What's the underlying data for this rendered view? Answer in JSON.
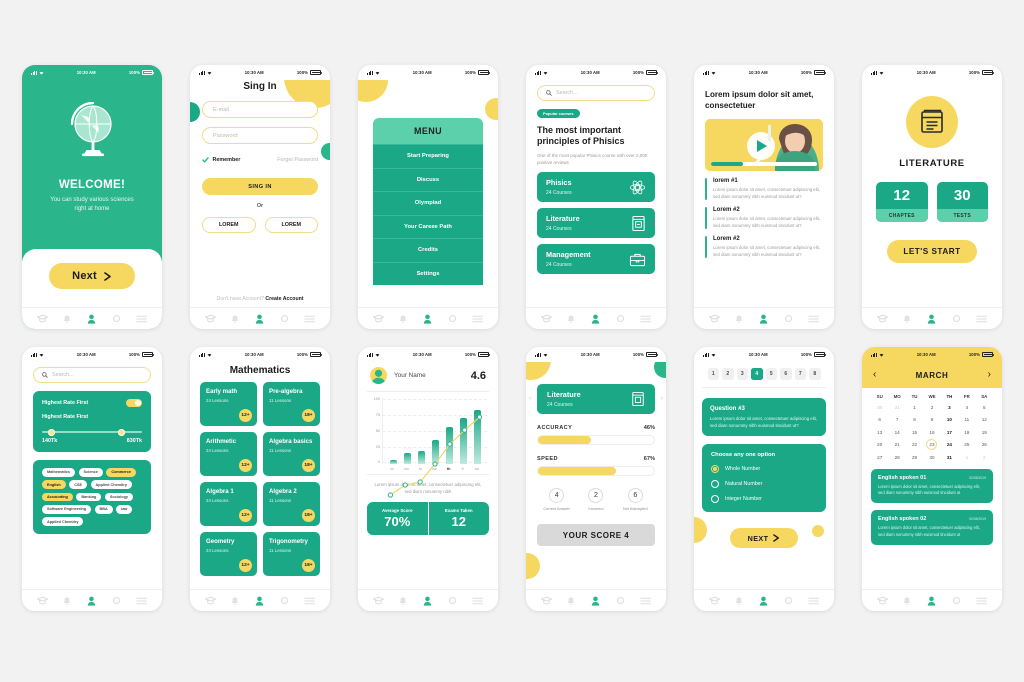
{
  "statusbar": {
    "time": "10:30 AM",
    "battery": "100%"
  },
  "nav": {
    "items": [
      {
        "name": "graduation-cap",
        "active": false
      },
      {
        "name": "bell",
        "active": false
      },
      {
        "name": "person",
        "active": true
      },
      {
        "name": "gear",
        "active": false
      },
      {
        "name": "menu",
        "active": false
      }
    ]
  },
  "colors": {
    "green": "#1aa887",
    "mint": "#2ab58a",
    "light_mint": "#5cd0aa",
    "yellow": "#f6d860",
    "text": "#1c1c1c"
  },
  "screens": {
    "welcome": {
      "title": "WELCOME!",
      "subtitle": "You can study various sciences right at home",
      "next_label": "Next",
      "icon": "globe-icon"
    },
    "signin": {
      "title": "Sing In",
      "email_placeholder": "E-mail",
      "password_placeholder": "Password",
      "remember_label": "Remember",
      "forgot_label": "Forget Password",
      "submit_label": "SING IN",
      "or_label": "Or",
      "social": [
        "LOREM",
        "LOREM"
      ],
      "footer_prefix": "Don't have Account?",
      "footer_link": "Create Account"
    },
    "menu": {
      "header": "MENU",
      "items": [
        "Start Preparing",
        "Discuss",
        "Olympiad",
        "Your Careee Path",
        "Credits",
        "Settings"
      ]
    },
    "courses": {
      "search_placeholder": "Search...",
      "badge": "Popular courses",
      "heading": "The most important principles of Phisics",
      "description": "One of the most popular Phisics course with over 2,000 positive reviews",
      "list": [
        {
          "name": "Phisics",
          "meta": "24 Courses",
          "icon": "atom-icon"
        },
        {
          "name": "Literature",
          "meta": "24 Courses",
          "icon": "book-icon"
        },
        {
          "name": "Management",
          "meta": "24 Courses",
          "icon": "briefcase-icon"
        }
      ]
    },
    "lesson": {
      "heading": "Lorem ipsum dolor sit amet, consectetuer",
      "progress_percent": 30,
      "items": [
        {
          "title": "lorem #1",
          "text": "Lorem ipsum dolor sit amet, consectetuer adipiscing elit, sed diam nonummy nibh euismod tincidunt ut?"
        },
        {
          "title": "Lorem #2",
          "text": "Lorem ipsum dolor sit amet, consectetuer adipiscing elit, sed diam nonummy nibh euismod tincidunt ut?"
        },
        {
          "title": "Lorem #2",
          "text": "Lorem ipsum dolor sit amet, consectetuer adipiscing elit, sed diam nonummy nibh euismod tincidunt ut?"
        }
      ]
    },
    "subject": {
      "title": "LITERATURE",
      "icon": "book-icon",
      "stats": [
        {
          "value": "12",
          "label": "CHAPTES"
        },
        {
          "value": "30",
          "label": "TESTS"
        }
      ],
      "cta": "LET'S START"
    },
    "filter": {
      "search_placeholder": "Search...",
      "toggle_label": "Highest Rate First",
      "slider_label": "Highest Rate First",
      "range_min": "140Tk",
      "range_max": "830Tk",
      "toggle_on": true,
      "tags": [
        {
          "label": "Mathematics",
          "selected": false
        },
        {
          "label": "Science",
          "selected": false
        },
        {
          "label": "Commerce",
          "selected": true
        },
        {
          "label": "English",
          "selected": true
        },
        {
          "label": "CSE",
          "selected": false
        },
        {
          "label": "Applied Chemitry",
          "selected": false
        },
        {
          "label": "Accounting",
          "selected": true
        },
        {
          "label": "Banking",
          "selected": false
        },
        {
          "label": "Sociology",
          "selected": false
        },
        {
          "label": "Software Engineering",
          "selected": false
        },
        {
          "label": "BBA",
          "selected": false
        },
        {
          "label": "law",
          "selected": false
        },
        {
          "label": "Applied Chemitry",
          "selected": false
        }
      ]
    },
    "mathematics": {
      "title": "Mathematics",
      "cards": [
        {
          "name": "Early math",
          "lessons": "24 Lessons",
          "age": "12+"
        },
        {
          "name": "Pre-algebra",
          "lessons": "11 Lessons",
          "age": "18+"
        },
        {
          "name": "Arithmetic",
          "lessons": "24 Lessons",
          "age": "12+"
        },
        {
          "name": "Algebra basics",
          "lessons": "11 Lessons",
          "age": "18+"
        },
        {
          "name": "Algebra 1",
          "lessons": "24 Lessons",
          "age": "12+"
        },
        {
          "name": "Algebra 2",
          "lessons": "11 Lessons",
          "age": "18+"
        },
        {
          "name": "Geometry",
          "lessons": "24 Lessons",
          "age": "12+"
        },
        {
          "name": "Trigonometry",
          "lessons": "11 Lessons",
          "age": "18+"
        }
      ]
    },
    "progress": {
      "user_name": "Your Name",
      "rating": "4.6",
      "note": "Lorem ipsum dolor sit amet, consectetuer adipiscing elit, sed diam nonummy nibh",
      "stats": [
        {
          "label": "Average Score",
          "value": "70%"
        },
        {
          "label": "Exams Taken",
          "value": "12"
        }
      ]
    },
    "score": {
      "course": {
        "name": "Literature",
        "meta": "24 Courses",
        "icon": "book-icon"
      },
      "metrics": [
        {
          "label": "ACCURACY",
          "value": "46%",
          "percent": 46
        },
        {
          "label": "SPEED",
          "value": "67%",
          "percent": 67
        }
      ],
      "counts": [
        {
          "value": "4",
          "label": "Correct Answer"
        },
        {
          "value": "2",
          "label": "Incorrect"
        },
        {
          "value": "6",
          "label": "Not Attempted"
        }
      ],
      "total_label": "YOUR SCORE 4"
    },
    "question": {
      "pages": [
        "1",
        "2",
        "3",
        "4",
        "5",
        "6",
        "7",
        "8"
      ],
      "active_page": "4",
      "question_title": "Question #3",
      "question_text": "Lorem ipsum dolor sit amet, consectetuer adipiscing elit, sed diam nonummy nibh euismod tincidunt ut?",
      "options_title": "Choose any one option",
      "options": [
        {
          "label": "Whole Number",
          "selected": true
        },
        {
          "label": "Natural Number",
          "selected": false
        },
        {
          "label": "Integer Number",
          "selected": false
        }
      ],
      "next_label": "NEXT"
    },
    "calendar": {
      "month": "MARCH",
      "prev_icon": "chevron-left-icon",
      "next_icon": "chevron-right-icon",
      "dow": [
        "SU",
        "MO",
        "TU",
        "WE",
        "TH",
        "FR",
        "SA"
      ],
      "current_dow": "TH",
      "weeks": [
        [
          {
            "d": "30",
            "mute": true
          },
          {
            "d": "31",
            "mute": true
          },
          {
            "d": "1"
          },
          {
            "d": "2"
          },
          {
            "d": "3",
            "bold": true
          },
          {
            "d": "4"
          },
          {
            "d": "5"
          }
        ],
        [
          {
            "d": "6"
          },
          {
            "d": "7"
          },
          {
            "d": "8"
          },
          {
            "d": "9"
          },
          {
            "d": "10",
            "bold": true
          },
          {
            "d": "11"
          },
          {
            "d": "12"
          }
        ],
        [
          {
            "d": "13"
          },
          {
            "d": "14",
            "fill": true
          },
          {
            "d": "15"
          },
          {
            "d": "16"
          },
          {
            "d": "17",
            "bold": true
          },
          {
            "d": "18"
          },
          {
            "d": "19"
          }
        ],
        [
          {
            "d": "20"
          },
          {
            "d": "21"
          },
          {
            "d": "22"
          },
          {
            "d": "23",
            "ring": true
          },
          {
            "d": "24",
            "bold": true
          },
          {
            "d": "25"
          },
          {
            "d": "26"
          }
        ],
        [
          {
            "d": "27"
          },
          {
            "d": "28"
          },
          {
            "d": "29"
          },
          {
            "d": "30"
          },
          {
            "d": "31",
            "bold": true
          },
          {
            "d": "1",
            "mute": true
          },
          {
            "d": "2",
            "mute": true
          }
        ]
      ],
      "events": [
        {
          "title": "English spoken 01",
          "date": "02/08/2019",
          "text": "Lorem ipsum dolor sit amet, consectetuer adipiscing elit, sed diam nonummy nibh euismod tincidunt ut"
        },
        {
          "title": "English spoken 02",
          "date": "02/08/2019",
          "text": "Lorem ipsum dolor sit amet, consectetuer adipiscing elit, sed diam nonummy nibh euismod tincidunt ut"
        }
      ]
    }
  },
  "chart_data": {
    "type": "bar",
    "title": "",
    "xlabel": "",
    "ylabel": "",
    "categories": [
      "su",
      "mo",
      "tu",
      "we",
      "th",
      "fr",
      "sa"
    ],
    "values": [
      7,
      17,
      20,
      38,
      58,
      72,
      85
    ],
    "line_values": [
      7,
      17,
      20,
      38,
      58,
      72,
      85
    ],
    "yticks": [
      0,
      25,
      50,
      75,
      100
    ],
    "ylim": [
      0,
      100
    ],
    "grid": true,
    "legend": "none",
    "highlight_category": "th"
  }
}
